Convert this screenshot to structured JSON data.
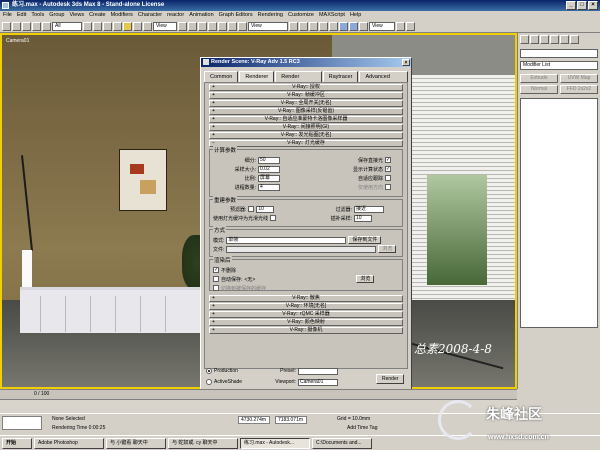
{
  "app": {
    "title": "练习.max - Autodesk 3ds Max 8 - Stand-alone License"
  },
  "menu": [
    "File",
    "Edit",
    "Tools",
    "Group",
    "Views",
    "Create",
    "Modifiers",
    "Character",
    "reactor",
    "Animation",
    "Graph Editors",
    "Rendering",
    "Customize",
    "MAXScript",
    "Help"
  ],
  "toolbar": {
    "selection_filter": "All",
    "ref_coord": "View",
    "named_sel": "View"
  },
  "viewport": {
    "label": "Camera01"
  },
  "watermark": "总素2008-4-8",
  "cmdpanel": {
    "modifier_list": "Modifier List",
    "buttons": [
      "Extrude",
      "UVW Map",
      "Normal",
      "FFD 2x2x2"
    ]
  },
  "dialog": {
    "title": "Render Scene: V-Ray Adv 1.5 RC3",
    "tabs": [
      "Common",
      "Renderer",
      "Render Elements",
      "Raytracer",
      "Advanced Lighting"
    ],
    "active_tab": "Renderer",
    "top_rollouts": [
      "V-Ray:: 授权",
      "V-Ray:: 帧缓冲区",
      "V-Ray:: 全局开关[无名]",
      "V-Ray:: 图像采样(反锯齿)",
      "V-Ray:: 自适应准蒙特卡洛图像采样器",
      "V-Ray:: 间接照明(GI)",
      "V-Ray:: 发光贴图[无名]",
      "V-Ray:: 灯光缓存"
    ],
    "calc": {
      "title": "计算参数",
      "subdivs_label": "细分:",
      "subdivs": "50",
      "sample_size_label": "采样大小:",
      "sample_size": "0.02",
      "scale_label": "比例:",
      "scale": "屏幕",
      "passes_label": "进程数量:",
      "passes": "4",
      "store_direct": "保存直接光",
      "show_phase": "显示计算状态",
      "adaptive": "自适应跟踪",
      "use_dirs": "仅使用方向"
    },
    "recon": {
      "title": "重建参数",
      "prefilter_label": "预滤器:",
      "prefilter": "10",
      "use_for_glossy": "使用灯光缓冲为光滑光线",
      "filter_label": "过滤器:",
      "filter": "接近",
      "interp_label": "插补采样:",
      "interp": "10"
    },
    "mode": {
      "title": "方式",
      "mode_label": "模式:",
      "mode": "单帧",
      "save_btn": "保存到文件",
      "file_label": "文件:",
      "browse_btn": "浏览"
    },
    "render_end": {
      "title": "渲染后",
      "dont_delete": "不删除",
      "auto_save": "自动保存:",
      "auto_save_val": "<无>",
      "browse_btn": "浏览",
      "switch_saved": "切换到被保存的缓存"
    },
    "bottom_rollouts": [
      "V-Ray:: 散焦",
      "V-Ray:: 环境[无名]",
      "V-Ray:: rQMC 采样器",
      "V-Ray:: 颜色映射",
      "V-Ray:: 摄像机"
    ],
    "production": "Production",
    "activeshade": "ActiveShade",
    "preset_label": "Preset:",
    "viewport_label": "Viewport:",
    "viewport_value": "Camera01",
    "render_btn": "Render"
  },
  "timeline": {
    "frame": "0 / 100"
  },
  "status": {
    "selection": "None Selected",
    "rendering_time": "Rendering Time 0:00:25",
    "grid": "Grid = 10.0mm",
    "add_time_tag": "Add Time Tag",
    "x": "4730.274m",
    "y": "7183.071m"
  },
  "taskbar": [
    "开始",
    "Adobe Photoshop",
    "与 小键看 聊天中",
    "与 蛇奴或. cy 聊天中",
    "练习.max - Autodesk...",
    "C:\\Documents and..."
  ],
  "logo": {
    "name": "朱峰社区",
    "url": "www.hxsd.com.cn"
  }
}
